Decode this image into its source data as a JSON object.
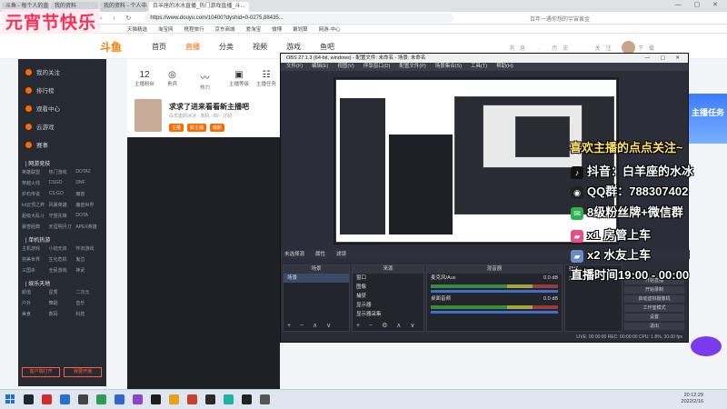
{
  "browser": {
    "tabs": [
      "斗鱼 - 每个人的直播平台",
      "我的资料",
      "我的资料 - 个人中心",
      "白羊座的冰冰直播_热门游戏直播_斗..."
    ],
    "url": "https://www.douyu.com/10400?dyshid=0-0275,88435...",
    "search_hint": "百年一遇你想的宇宙黄金",
    "bookmarks": [
      "天猫精选",
      "淘宝网",
      "携程旅行",
      "京东商城",
      "爱淘宝",
      "微博",
      "聚划算",
      "网游-中心"
    ]
  },
  "watermark": "元宵节快乐",
  "site": {
    "logo": "斗鱼",
    "nav": [
      "首页",
      "直播",
      "分类",
      "视频",
      "游戏",
      "鱼吧"
    ],
    "nav_active": "直播",
    "top_icons": "消息 · 历史 · 关注 · 下载"
  },
  "sidebar": {
    "items": [
      "我的关注",
      "排行榜",
      "观看中心",
      "云游戏",
      "赛事"
    ],
    "section_hot": "| 网游竞技",
    "hot_games": [
      "英雄联盟",
      "热门游戏",
      "DOTA2",
      "穿越火线",
      "CSGO",
      "DNF",
      "炉石传说",
      "CS:GO",
      "魔兽",
      "lol云顶之弈",
      "风暴英雄",
      "魔兽世界",
      "超级大乱斗",
      "守望先锋",
      "DOTA",
      "暴雪经典",
      "天涯明月刀",
      "APEX英雄"
    ],
    "section_mobile": "| 单机热游",
    "mobile_games": [
      "主机游戏",
      "小炮无双",
      "怀旧游戏",
      "完美世界",
      "生化危机",
      "鬼泣",
      "三国杀",
      "全民游戏",
      "神武"
    ],
    "section_fun": "| 娱乐天地",
    "fun": [
      "颜值",
      "星秀",
      "二次元",
      "户外",
      "舞蹈",
      "音乐",
      "美食",
      "数码",
      "科技"
    ],
    "buttons": [
      "客户端打开",
      "我要开播"
    ]
  },
  "stats": [
    {
      "num": "12",
      "label": "主播粉丝"
    },
    {
      "num": "",
      "label": "贵宾"
    },
    {
      "num": "",
      "label": "热力"
    },
    {
      "num": "",
      "label": "主播等级"
    },
    {
      "num": "",
      "label": "主播任务"
    }
  ],
  "room": {
    "title": "求求了进来看看新主播吧",
    "sub": "白羊座的冰冰 · 单机 · 80 · 订阅",
    "tags": [
      "主播",
      "新主播",
      "萌新"
    ]
  },
  "obs": {
    "title": "OBS 27.1.3 (64-bit, windows) - 配置文件: 未命名 - 场景: 未命名",
    "menu": [
      "文件(F)",
      "编辑(E)",
      "视图(V)",
      "停靠窗口(D)",
      "配置文件(P)",
      "场景集合(S)",
      "工具(T)",
      "帮助(H)"
    ],
    "controls": [
      "未选择源",
      "属性",
      "滤镜"
    ],
    "scenes_head": "场景",
    "scenes": [
      "场景"
    ],
    "sources_head": "来源",
    "sources": [
      "窗口",
      "图像",
      "捕获",
      "显示器",
      "显示器采集"
    ],
    "mixer_head": "混音器",
    "mixer": [
      {
        "name": "麦克风/Aux",
        "db": "0.0 dB"
      },
      {
        "name": "桌面音频",
        "db": "0.0 dB"
      }
    ],
    "side_buttons": [
      "开始直播",
      "开始录制",
      "启动虚拟摄像机",
      "工作室模式",
      "设置",
      "退出"
    ],
    "transition_label": "转场",
    "duration": "300 ms",
    "status": "LIVE: 00:00:00  REC: 00:00:00  CPU: 1.8%, 30.00 fps"
  },
  "overlay": {
    "line1": "喜欢主播的点点关注~",
    "line2": "抖音：白羊座的水冰",
    "line3": "QQ群：788307402",
    "line4": "8级粉丝牌+微信群",
    "line5": "x1 房管上车",
    "line6": "x2 水友上车",
    "line7": "直播时间19:00 - 00:00"
  },
  "promo": "主播任务",
  "clock": {
    "time": "20:12:29",
    "date": "2022/2/16"
  },
  "colors": {
    "accent": "#ff6a00",
    "watermark": "#ff2d55",
    "obs_bg": "#2b2e38"
  }
}
